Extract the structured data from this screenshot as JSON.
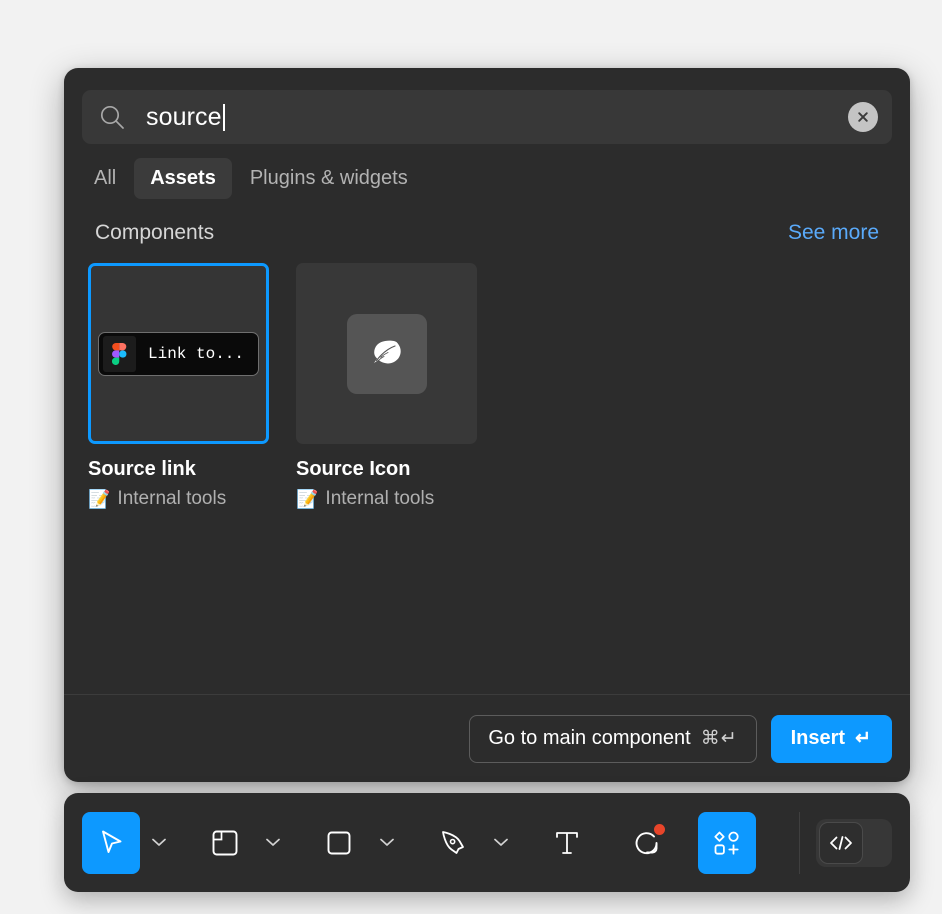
{
  "theme": {
    "page_background": "#f2f2f2",
    "panel_background": "#2c2c2c",
    "accent_blue": "#0d99ff",
    "link_blue": "#5aaafa",
    "badge_red": "#e8452a"
  },
  "search": {
    "value": "source",
    "icon": "search-icon",
    "clear_icon": "close-circle-icon"
  },
  "tabs": [
    {
      "label": "All",
      "active": false
    },
    {
      "label": "Assets",
      "active": true
    },
    {
      "label": "Plugins & widgets",
      "active": false
    }
  ],
  "section": {
    "title": "Components",
    "see_more_label": "See more"
  },
  "results": [
    {
      "title": "Source link",
      "library_emoji": "📝",
      "library": "Internal tools",
      "selected": true,
      "preview_type": "link-chip",
      "preview_text": "Link to...",
      "preview_icon": "figma-logo-icon"
    },
    {
      "title": "Source Icon",
      "library_emoji": "📝",
      "library": "Internal tools",
      "selected": false,
      "preview_type": "icon-tile",
      "preview_icon": "feather-icon"
    }
  ],
  "footer": {
    "go_to_main_label": "Go to main component",
    "go_to_main_shortcut": "⌘↵",
    "insert_label": "Insert",
    "insert_shortcut": "↵"
  },
  "toolbar": {
    "tools": [
      {
        "name": "move-tool",
        "icon": "cursor-icon",
        "active": true,
        "has_chevron": true
      },
      {
        "name": "frame-tool",
        "icon": "frame-icon",
        "active": false,
        "has_chevron": true
      },
      {
        "name": "shape-tool",
        "icon": "square-icon",
        "active": false,
        "has_chevron": true
      },
      {
        "name": "pen-tool",
        "icon": "pen-icon",
        "active": false,
        "has_chevron": true
      },
      {
        "name": "text-tool",
        "icon": "text-t-icon",
        "active": false,
        "has_chevron": false
      },
      {
        "name": "comment-tool",
        "icon": "comment-icon",
        "active": false,
        "has_chevron": false,
        "has_badge": true
      },
      {
        "name": "resources-tool",
        "icon": "resources-icon",
        "active": true,
        "has_chevron": false
      }
    ],
    "devmode": {
      "name": "dev-mode-toggle",
      "icon": "code-brackets-icon",
      "enabled": false
    }
  }
}
